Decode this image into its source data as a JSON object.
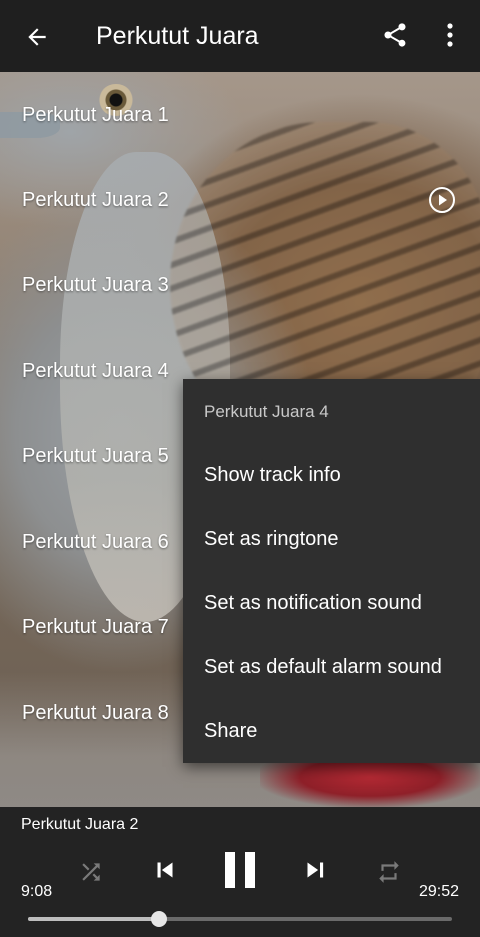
{
  "app_bar": {
    "title": "Perkutut Juara",
    "back_icon": "arrow-left-icon",
    "share_icon": "share-icon",
    "more_icon": "more-vert-icon"
  },
  "tracks": [
    {
      "name": "Perkutut Juara 1",
      "playing": false
    },
    {
      "name": "Perkutut Juara 2",
      "playing": true
    },
    {
      "name": "Perkutut Juara 3",
      "playing": false
    },
    {
      "name": "Perkutut Juara 4",
      "playing": false
    },
    {
      "name": "Perkutut Juara 5",
      "playing": false
    },
    {
      "name": "Perkutut Juara 6",
      "playing": false
    },
    {
      "name": "Perkutut Juara 7",
      "playing": false
    },
    {
      "name": "Perkutut Juara 8",
      "playing": false
    }
  ],
  "context_menu": {
    "header": "Perkutut Juara 4",
    "items": [
      "Show track info",
      "Set as ringtone",
      "Set as notification sound",
      "Set as default alarm sound",
      "Share"
    ]
  },
  "player": {
    "now_playing": "Perkutut Juara 2",
    "elapsed": "9:08",
    "total": "29:52",
    "progress": 0.31,
    "state": "playing"
  },
  "colors": {
    "app_bar": "#1f1f1f",
    "menu_bg": "#2f2f2f",
    "player_bg": "#232323"
  }
}
